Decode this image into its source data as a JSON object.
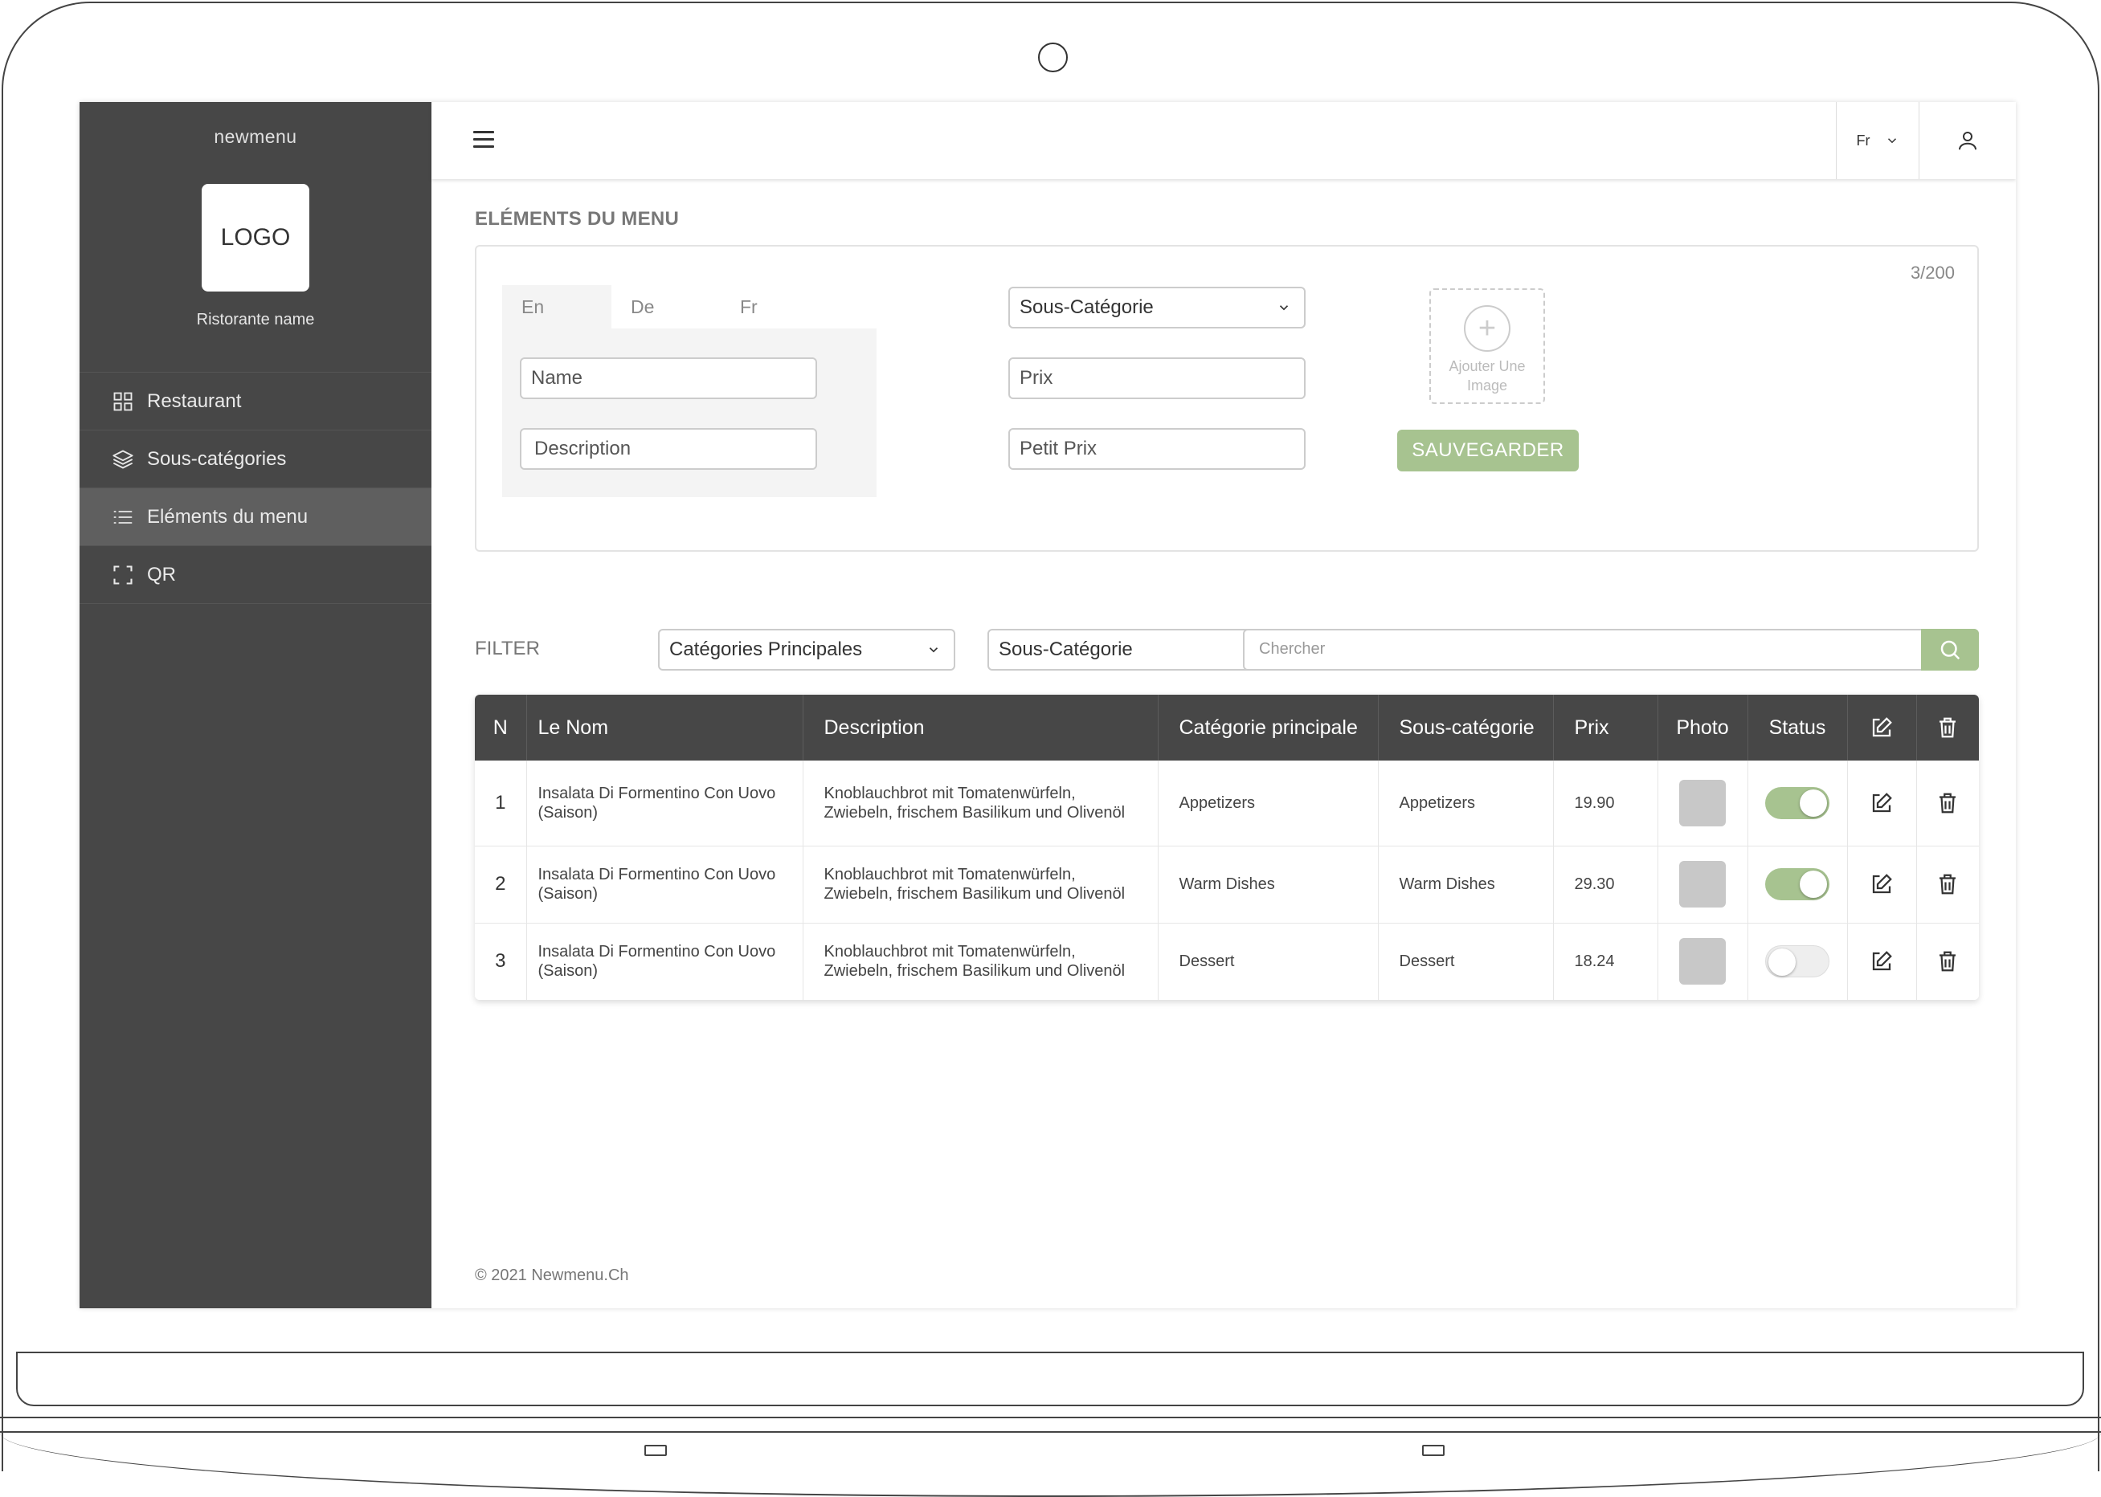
{
  "sidebar": {
    "brand": "newmenu",
    "logo": "LOGO",
    "restaurant_name": "Ristorante name",
    "items": [
      {
        "label": "Restaurant",
        "icon": "grid-icon"
      },
      {
        "label": "Sous-catégories",
        "icon": "layers-icon"
      },
      {
        "label": "Eléments du menu",
        "icon": "list-icon",
        "active": true
      },
      {
        "label": "QR",
        "icon": "qr-scan-icon"
      }
    ]
  },
  "topbar": {
    "language": "Fr"
  },
  "form": {
    "title": "ELÉMENTS DU MENU",
    "counter": "3/200",
    "lang_tabs": [
      "En",
      "De",
      "Fr"
    ],
    "name_placeholder": "Name",
    "description_placeholder": "Description",
    "subcategory_select": "Sous-Catégorie",
    "price_placeholder": "Prix",
    "small_price_placeholder": "Petit Prix",
    "add_image_line1": "Ajouter Une",
    "add_image_line2": "Image",
    "save_label": "SAUVEGARDER"
  },
  "filter": {
    "label": "FILTER",
    "main_category": "Catégories Principales",
    "subcategory": "Sous-Catégorie",
    "search_placeholder": "Chercher"
  },
  "table": {
    "headers": [
      "N",
      "Le Nom",
      "Description",
      "Catégorie principale",
      "Sous-catégorie",
      "Prix",
      "Photo",
      "Status"
    ],
    "rows": [
      {
        "n": "1",
        "name_line1": "Insalata Di Formentino Con Uovo",
        "name_line2": "(Saison)",
        "desc_line1": "Knoblauchbrot mit Tomatenwürfeln,",
        "desc_line2": "Zwiebeln, frischem Basilikum und Olivenöl",
        "category": "Appetizers",
        "subcategory": "Appetizers",
        "price": "19.90",
        "status": true
      },
      {
        "n": "2",
        "name_line1": "Insalata Di Formentino Con Uovo",
        "name_line2": "(Saison)",
        "desc_line1": "Knoblauchbrot mit Tomatenwürfeln,",
        "desc_line2": "Zwiebeln, frischem Basilikum und Olivenöl",
        "category": "Warm Dishes",
        "subcategory": "Warm Dishes",
        "price": "29.30",
        "status": true
      },
      {
        "n": "3",
        "name_line1": "Insalata Di Formentino Con Uovo",
        "name_line2": "(Saison)",
        "desc_line1": "Knoblauchbrot mit Tomatenwürfeln,",
        "desc_line2": "Zwiebeln, frischem Basilikum und Olivenöl",
        "category": "Dessert",
        "subcategory": "Dessert",
        "price": "18.24",
        "status": false
      }
    ]
  },
  "footer": {
    "text": "© 2021  Newmenu.Ch"
  },
  "colors": {
    "sidebar": "#474747",
    "accent": "#a7c390",
    "table_header": "#474747"
  }
}
